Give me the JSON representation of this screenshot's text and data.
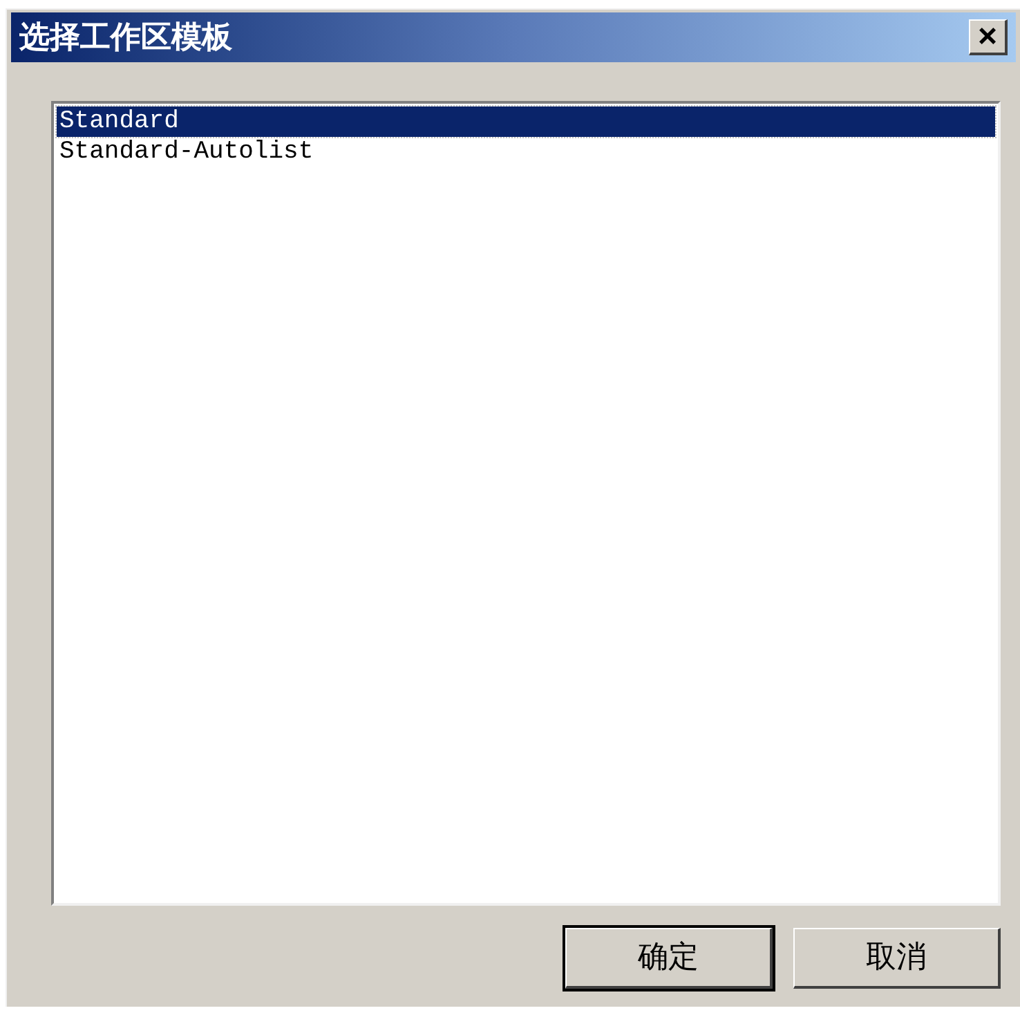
{
  "window": {
    "title": "选择工作区模板",
    "close": "×"
  },
  "list": {
    "items": [
      {
        "label": "Standard",
        "selected": true
      },
      {
        "label": "Standard-Autolist",
        "selected": false
      }
    ]
  },
  "buttons": [
    {
      "label": "确定",
      "default": true
    },
    {
      "label": "取消",
      "default": false
    }
  ]
}
